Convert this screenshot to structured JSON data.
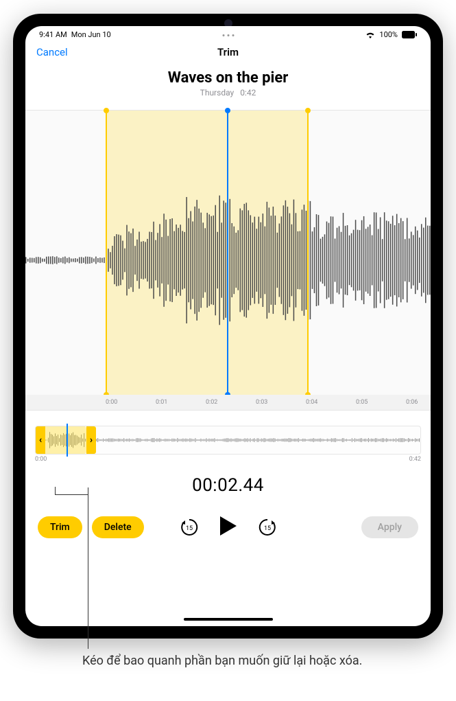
{
  "status": {
    "time": "9:41 AM",
    "date": "Mon Jun 10",
    "battery": "100%"
  },
  "nav": {
    "cancel": "Cancel",
    "title": "Trim"
  },
  "recording": {
    "title": "Waves on the pier",
    "day": "Thursday",
    "duration": "0:42"
  },
  "ruler": {
    "t0": "0:00",
    "t1": "0:01",
    "t2": "0:02",
    "t3": "0:03",
    "t4": "0:04",
    "t5": "0:05",
    "t6": "0:06"
  },
  "overview": {
    "start": "0:00",
    "end": "0:42"
  },
  "playback": {
    "current_time": "00:02.44"
  },
  "buttons": {
    "trim": "Trim",
    "delete": "Delete",
    "apply": "Apply"
  },
  "callout": "Kéo để bao quanh phần bạn muốn giữ lại hoặc xóa."
}
